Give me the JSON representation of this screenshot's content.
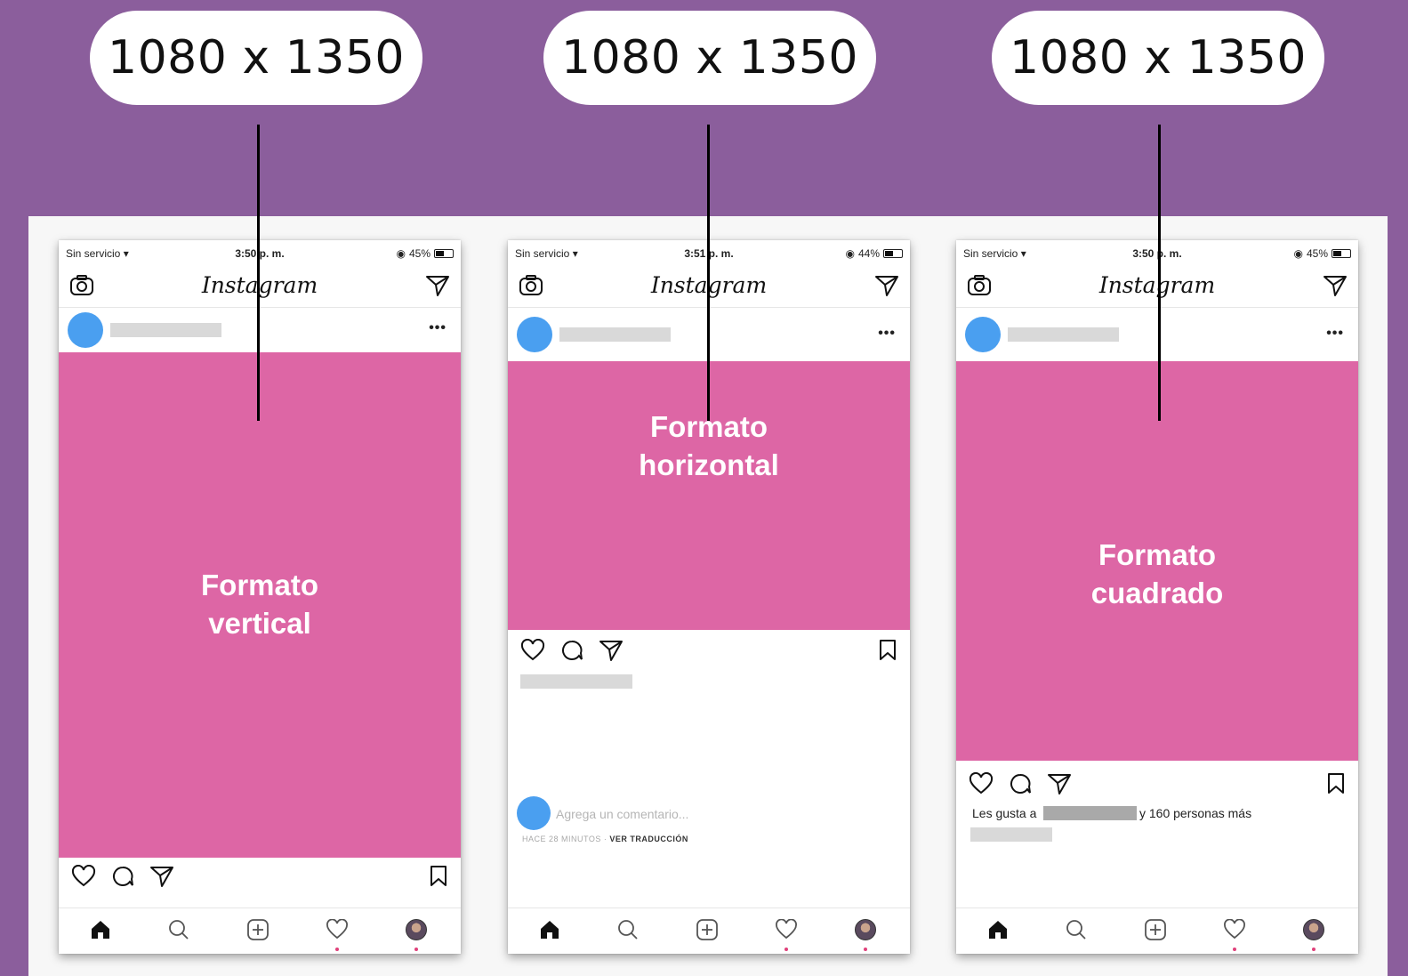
{
  "colors": {
    "background": "#8b5e9c",
    "panel": "#f7f7f7",
    "media_pink": "#dd66a5",
    "avatar_blue": "#4a9ff0",
    "placeholder_gray": "#d9d9d9"
  },
  "dimension_labels": [
    "1080 x 1350",
    "1080 x 1350",
    "1080 x 1350"
  ],
  "phones": [
    {
      "status": {
        "carrier": "Sin servicio",
        "time": "3:50 p. m.",
        "battery": "45%"
      },
      "app_title": "Instagram",
      "media_label": "Formato\nvertical",
      "more_dots": "•••"
    },
    {
      "status": {
        "carrier": "Sin servicio",
        "time": "3:51 p. m.",
        "battery": "44%"
      },
      "app_title": "Instagram",
      "media_label": "Formato\nhorizontal",
      "more_dots": "•••",
      "comment_placeholder": "Agrega un comentario...",
      "time_ago": "HACE 28 MINUTOS · ",
      "translate_link": "VER TRADUCCIÓN"
    },
    {
      "status": {
        "carrier": "Sin servicio",
        "time": "3:50 p. m.",
        "battery": "45%"
      },
      "app_title": "Instagram",
      "media_label": "Formato\ncuadrado",
      "more_dots": "•••",
      "likes_prefix": "Les gusta a",
      "likes_suffix": "y 160 personas más"
    }
  ],
  "icons": {
    "camera": "camera-icon",
    "direct": "send-icon",
    "like": "heart-icon",
    "comment": "comment-icon",
    "share": "send-icon",
    "save": "bookmark-icon",
    "nav": [
      "home-icon",
      "search-icon",
      "add-icon",
      "activity-heart-icon",
      "profile-icon"
    ]
  }
}
